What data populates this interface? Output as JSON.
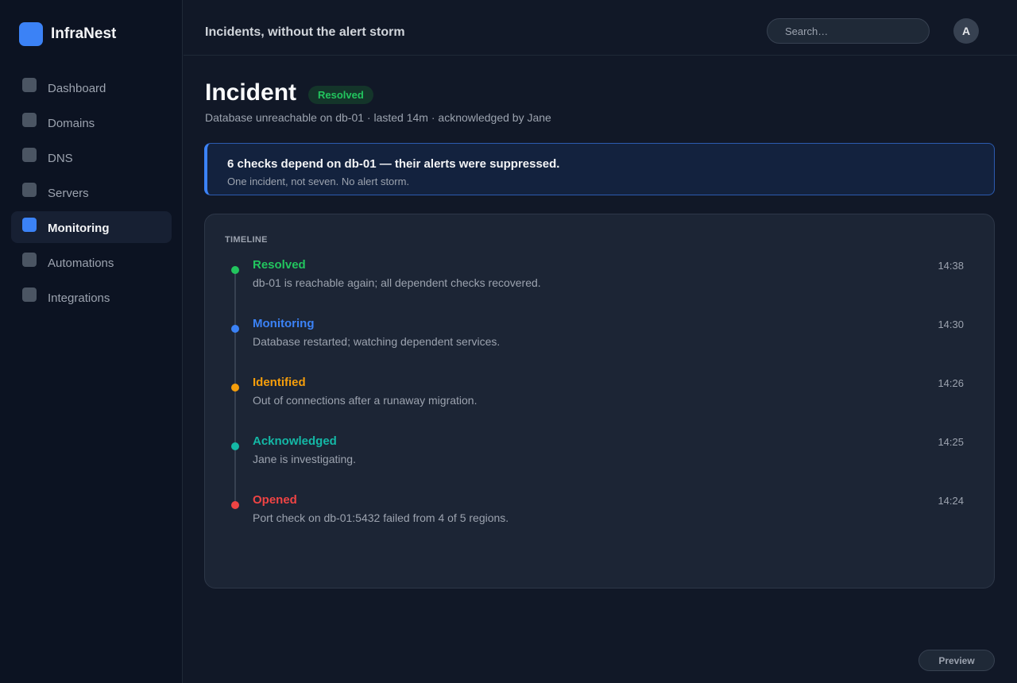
{
  "app": {
    "name": "InfraNest"
  },
  "sidebar": {
    "items": [
      {
        "label": "Dashboard",
        "active": false
      },
      {
        "label": "Domains",
        "active": false
      },
      {
        "label": "DNS",
        "active": false
      },
      {
        "label": "Servers",
        "active": false
      },
      {
        "label": "Monitoring",
        "active": true
      },
      {
        "label": "Automations",
        "active": false
      },
      {
        "label": "Integrations",
        "active": false
      }
    ]
  },
  "header": {
    "tagline": "Incidents, without the alert storm",
    "search_placeholder": "Search…",
    "avatar_initial": "A"
  },
  "incident": {
    "title": "Incident",
    "status": "Resolved",
    "summary": "Database unreachable on db-01 · lasted 14m · acknowledged by Jane"
  },
  "banner": {
    "title": "6 checks depend on db-01 — their alerts were suppressed.",
    "text": "One incident, not seven. No alert storm."
  },
  "timeline": {
    "heading": "TIMELINE",
    "events": [
      {
        "status": "Resolved",
        "description": "db-01 is reachable again; all dependent checks recovered.",
        "time": "14:38",
        "color": "#22c55e"
      },
      {
        "status": "Monitoring",
        "description": "Database restarted; watching dependent services.",
        "time": "14:30",
        "color": "#3b82f6"
      },
      {
        "status": "Identified",
        "description": "Out of connections after a runaway migration.",
        "time": "14:26",
        "color": "#f59e0b"
      },
      {
        "status": "Acknowledged",
        "description": "Jane is investigating.",
        "time": "14:25",
        "color": "#14b8a6"
      },
      {
        "status": "Opened",
        "description": "Port check on db-01:5432 failed from 4 of 5 regions.",
        "time": "14:24",
        "color": "#ef4444"
      }
    ]
  },
  "footer": {
    "preview_label": "Preview"
  },
  "colors": {
    "accent": "#3b82f6",
    "success": "#22c55e",
    "background": "#111827",
    "sidebar": "#0c1322"
  }
}
